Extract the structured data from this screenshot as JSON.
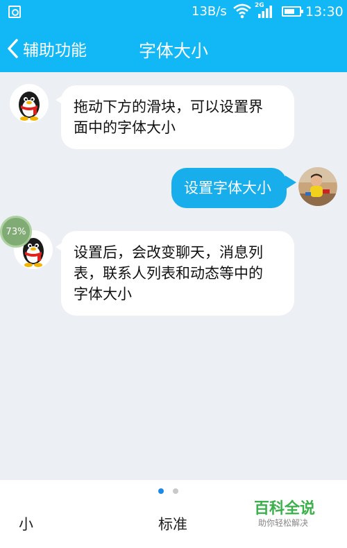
{
  "status_bar": {
    "network_speed": "13B/s",
    "network_type": "2G",
    "time": "13:30",
    "battery_level": 0.7,
    "icons": [
      "gallery-icon",
      "wifi-icon",
      "signal-icon",
      "battery-icon"
    ]
  },
  "header": {
    "back_label": "辅助功能",
    "title": "字体大小",
    "background_color": "#12b7f5"
  },
  "messages": [
    {
      "side": "left",
      "avatar": "qq-penguin-avatar",
      "text_lines": [
        "拖动下方的滑块，可以设置界",
        "面中的字体大小"
      ]
    },
    {
      "side": "right",
      "avatar": "user-photo-avatar",
      "text": "设置字体大小"
    },
    {
      "side": "left",
      "avatar": "qq-penguin-avatar",
      "text_lines": [
        "设置后，会改变聊天，消息列",
        "表，联系人列表和动态等中的",
        "字体大小"
      ]
    }
  ],
  "overlay_badge": "73%",
  "font_size_options": {
    "small": "小",
    "standard": "标准"
  },
  "pager": {
    "pages": 2,
    "current": 1
  },
  "watermark": {
    "title": "百科全说",
    "subtitle": "助你轻松解决"
  }
}
